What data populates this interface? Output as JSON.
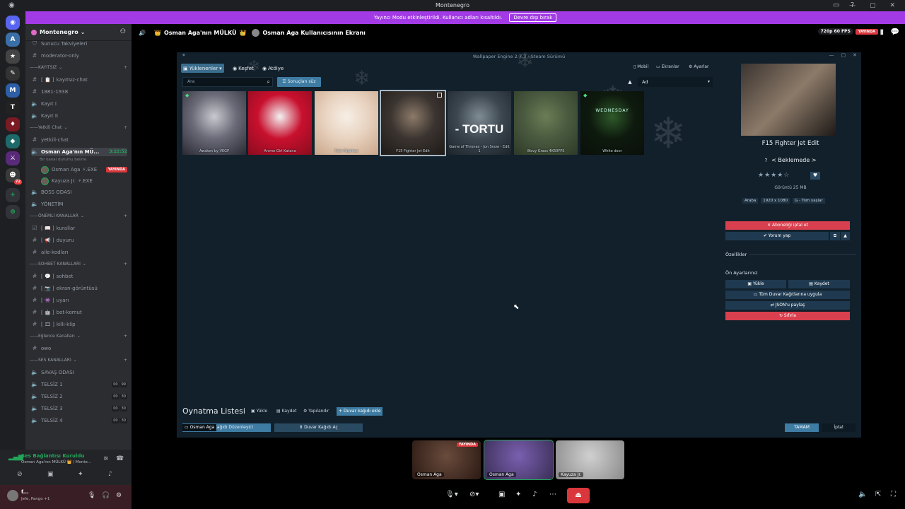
{
  "window": {
    "title": "Montenegro"
  },
  "banner": {
    "text": "Yayıncı Modu etkinleştirildi. Kullanıcı adları kısaltıldı.",
    "button": "Devre dışı bırak"
  },
  "server": {
    "name": "Montenegro"
  },
  "channels": [
    {
      "type": "text",
      "icon": "boost-icon",
      "label": "Sunucu Takviyeleri"
    },
    {
      "type": "text",
      "icon": "hash-icon",
      "label": "moderator-only"
    },
    {
      "type": "category",
      "label": "KAYITSIZ"
    },
    {
      "type": "text",
      "icon": "hash-icon",
      "label": "kayıtsız-chat",
      "prefix": "[ 📋 ]"
    },
    {
      "type": "text",
      "icon": "hash-icon",
      "label": "1881-1938"
    },
    {
      "type": "voice",
      "icon": "speaker-icon",
      "label": "Kayıt I"
    },
    {
      "type": "voice",
      "icon": "speaker-icon",
      "label": "Kayıt II"
    },
    {
      "type": "category",
      "label": "Yetkili Chat"
    },
    {
      "type": "text",
      "icon": "hash-icon",
      "label": "yetkili-chat"
    },
    {
      "type": "voice-active",
      "icon": "speaker-icon",
      "label": "Osman Aga'nın MÜ...",
      "time": "3:22:52"
    },
    {
      "type": "sub",
      "label": "Bir kanal durumu belirle"
    },
    {
      "type": "user",
      "label": "Osman Aga",
      "suffix": "⚡.EXE",
      "live": "YAYINDA"
    },
    {
      "type": "user",
      "label": "Kayuza Jr.",
      "suffix": "⚡.EXE"
    },
    {
      "type": "voice",
      "icon": "speaker-icon",
      "label": "BOSS ODASI"
    },
    {
      "type": "voice",
      "icon": "speaker-icon",
      "label": "YÖNETİM"
    },
    {
      "type": "category",
      "label": "ÖNEMLİ KANALLAR"
    },
    {
      "type": "text",
      "icon": "rules-icon",
      "label": "kurallar",
      "prefix": "[ 📖 ]"
    },
    {
      "type": "text",
      "icon": "hash-icon",
      "label": "duyuru",
      "prefix": "[ 📢 ]"
    },
    {
      "type": "text",
      "icon": "hash-icon",
      "label": "aile-kodları"
    },
    {
      "type": "category",
      "label": "SOHBET KANALLARI"
    },
    {
      "type": "text",
      "icon": "hash-icon",
      "label": "sohbet",
      "prefix": "[ 💬 ]"
    },
    {
      "type": "text",
      "icon": "hash-icon",
      "label": "ekran-görüntüsü",
      "prefix": "[ 📷 ]"
    },
    {
      "type": "text",
      "icon": "hash-icon",
      "label": "uyarı",
      "prefix": "[ 👾 ]"
    },
    {
      "type": "text",
      "icon": "hash-icon",
      "label": "bot-komut",
      "prefix": "[ 🤖 ]"
    },
    {
      "type": "text",
      "icon": "hash-icon",
      "label": "killi-klip",
      "prefix": "[ 🎞 ]"
    },
    {
      "type": "category",
      "label": "Eğlence Kanalları"
    },
    {
      "type": "text",
      "icon": "hash-icon",
      "label": "owo"
    },
    {
      "type": "category",
      "label": "SES KANALLARI"
    },
    {
      "type": "voice",
      "icon": "speaker-icon",
      "label": "SAVAŞ ODASI"
    },
    {
      "type": "voice-count",
      "icon": "speaker-icon",
      "label": "TELSİZ 1",
      "c1": "00",
      "c2": "99"
    },
    {
      "type": "voice-count",
      "icon": "speaker-icon",
      "label": "TELSİZ 2",
      "c1": "00",
      "c2": "30"
    },
    {
      "type": "voice-count",
      "icon": "speaker-icon",
      "label": "TELSİZ 3",
      "c1": "00",
      "c2": "30"
    },
    {
      "type": "voice-count",
      "icon": "speaker-icon",
      "label": "TELSİZ 4",
      "c1": "00",
      "c2": "30"
    }
  ],
  "voice": {
    "status": "Ses Bağlantısı Kuruldu",
    "sub": "Osman Aga'nın MÜLKÜ 👑 / Monte..."
  },
  "user": {
    "name": "f...",
    "status": "Jefe, Pango +1"
  },
  "stream_header": {
    "channel": "Osman Aga'nın MÜLKÜ",
    "screen": "Osman Aga Kullanıcısının Ekranı",
    "quality": "720p 60 FPS",
    "live": "YAYINDA"
  },
  "we": {
    "title": "Wallpaper Engine 2.7.3 - Steam Sürümü",
    "tabs": [
      "Yüklenenler",
      "Keşfet",
      "Atölye"
    ],
    "right_tabs": [
      "Mobil",
      "Ekranlar",
      "Ayarlar"
    ],
    "search_placeholder": "Ara",
    "filter": "Sonuçları süz",
    "sort": "Ad",
    "wallpapers": [
      {
        "name": "Awaken by VEGP",
        "colors": [
          "#6a6a78",
          "#c9c9cf",
          "#2a2a34"
        ]
      },
      {
        "name": "Anime Girl Katana",
        "colors": [
          "#c8102e",
          "#f2f2f2",
          "#8a0c1f"
        ]
      },
      {
        "name": "Fete Pajamas",
        "colors": [
          "#e8d3c0",
          "#f7efe6",
          "#caa68a"
        ]
      },
      {
        "name": "F15 Fighter Jet Edit",
        "colors": [
          "#3b3430",
          "#8c7a69",
          "#1e1a17"
        ]
      },
      {
        "name": "Game of Thrones - Jon Snow - Edit 1",
        "colors": [
          "#3c4750",
          "#808c93",
          "#1c232a"
        ]
      },
      {
        "name": "Wavy Grass 4K60FPS",
        "colors": [
          "#4a5a3f",
          "#6b7d56",
          "#2e3a28"
        ]
      },
      {
        "name": "White door",
        "colors": [
          "#0e1a0e",
          "#2e5a2a",
          "#0a0f0a"
        ]
      }
    ],
    "tortu_text": "TORTU",
    "wednesday_text": "WEDNESDAY",
    "playlist": {
      "title": "Oynatma Listesi",
      "buttons": [
        "Yükle",
        "Kaydet",
        "Yapılandır",
        "Duvar kağıdı ekle"
      ]
    },
    "bottom": {
      "editor": "Duvar Kağıdı Düzenleyici",
      "open": "Duvar Kağıdı Aç",
      "ok": "TAMAM",
      "cancel": "İptal"
    },
    "detail": {
      "title": "F15 Fighter Jet Edit",
      "status": "< Beklemede >",
      "views": "Görüntü 25 MB",
      "tags": [
        "Araba",
        "1920 x 1080",
        "G - Tüm yaşlar"
      ],
      "unsubscribe": "Aboneliği iptal et",
      "comment": "Yorum yap",
      "properties": "Özellikler",
      "presets": "Ön Ayarlarınız",
      "load": "Yükle",
      "save": "Kaydet",
      "apply_all": "Tüm Duvar Kağıtlarına uygula",
      "share_json": "JSON'u paylaş",
      "reset": "Sıfırla",
      "rating": 4
    }
  },
  "tiles": [
    {
      "name": "Osman Aga",
      "live": "YAYINDA",
      "colors": [
        "#2b1a14",
        "#6a4b3c"
      ]
    },
    {
      "name": "Osman Aga",
      "colors": [
        "#3a2f56",
        "#7a5fb0"
      ]
    },
    {
      "name": "Kayuza Jr.",
      "colors": [
        "#8a8a8a",
        "#d0d0d0"
      ]
    }
  ],
  "stream_tile_label": "Osman Aga"
}
